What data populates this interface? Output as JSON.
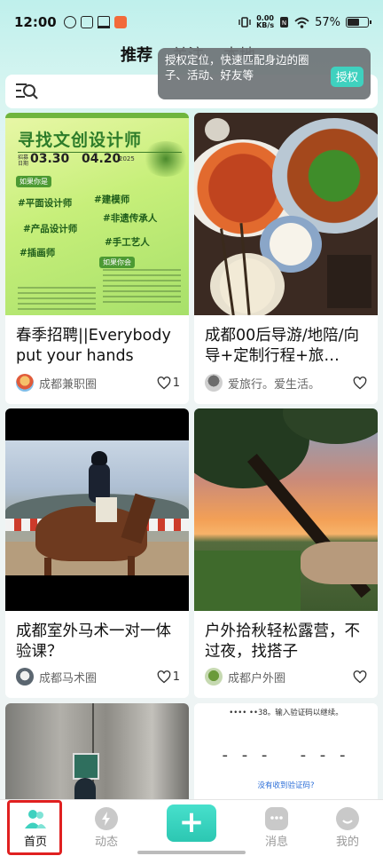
{
  "status_bar": {
    "time": "12:00",
    "net_speed_top": "0.00",
    "net_speed_bottom": "KB/s",
    "battery": "57%"
  },
  "tabs": [
    {
      "label": "推荐",
      "active": true
    },
    {
      "label": "关注"
    },
    {
      "label": "本地"
    }
  ],
  "permission_toast": {
    "text": "授权定位，快速匹配身边的圈子、活动、好友等",
    "button": "授权"
  },
  "feed": [
    {
      "title": "春季招聘||Everybody put your hands",
      "circle": "成都兼职圈",
      "likes": "1",
      "poster": {
        "heading": "寻找文创设计师",
        "start_label": "招募日期",
        "start_date": "03.30",
        "end_date": "04.20",
        "year": "2025",
        "you_are": "如果你是",
        "roles": [
          "#平面设计师",
          "#建模师",
          "#产品设计师",
          "#非遗传承人",
          "#插画师",
          "#手工艺人"
        ],
        "if_you": "如果你会"
      }
    },
    {
      "title": "成都00后导游/地陪/向导+定制行程+旅…",
      "circle": "爱旅行。爱生活。",
      "likes": ""
    },
    {
      "title": "成都室外马术一对一体验课？",
      "circle": "成都马术圈",
      "likes": "1"
    },
    {
      "title": "户外拾秋轻松露营，不过夜，找搭子",
      "circle": "成都户外圈",
      "likes": ""
    },
    {
      "title": "",
      "circle": "",
      "likes": ""
    },
    {
      "title": "",
      "circle": "",
      "likes": "",
      "verify_prompt": "•••• ••38。输入验证码以继续。",
      "verify_dashes": "- - -   - - -",
      "verify_link": "没有收到验证码?"
    }
  ],
  "bottom_nav": [
    {
      "label": "首页",
      "icon": "home-people-icon",
      "active": true
    },
    {
      "label": "动态",
      "icon": "lightning-icon"
    },
    {
      "label": "",
      "icon": "plus-icon"
    },
    {
      "label": "消息",
      "icon": "chat-bubble-icon"
    },
    {
      "label": "我的",
      "icon": "smile-icon"
    }
  ],
  "colors": {
    "accent": "#3fd1bf",
    "highlight_border": "#e02020",
    "toast_bg": "#6e7376"
  }
}
